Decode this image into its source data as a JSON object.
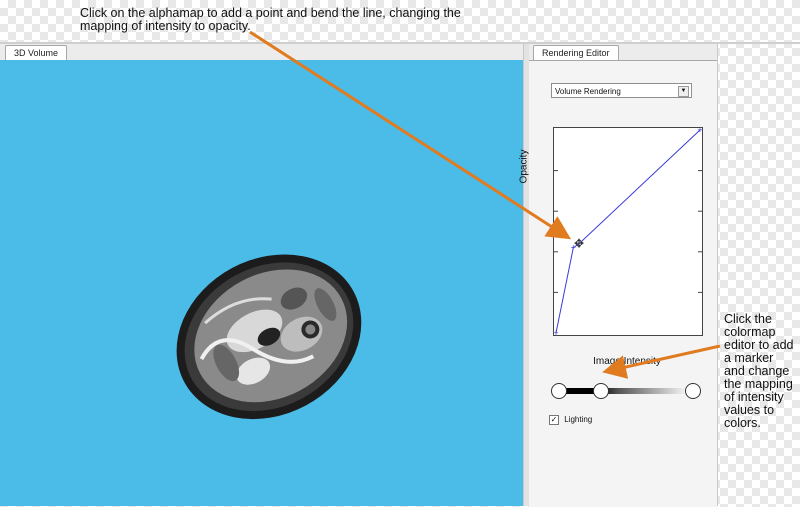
{
  "callouts": {
    "top": "Click on the alphamap to add a point and bend the line, changing the mapping of intensity to opacity.",
    "right": "Click the colormap editor to add a marker and change the mapping of intensity values to colors."
  },
  "left_panel": {
    "tab": "3D Volume"
  },
  "right_panel": {
    "tab": "Rendering Editor",
    "dropdown_value": "Volume Rendering",
    "lighting_label": "Lighting",
    "lighting_checked": true
  },
  "chart_data": {
    "type": "line",
    "xlabel": "Image Intensity",
    "ylabel": "Opacity",
    "xlim": [
      0,
      1
    ],
    "ylim": [
      0,
      1
    ],
    "series": [
      {
        "x": [
          0.0,
          0.12,
          0.16,
          1.0
        ],
        "y": [
          0.0,
          0.42,
          0.44,
          1.0
        ]
      }
    ]
  },
  "colormap_markers": [
    0.0,
    0.31,
    1.0
  ],
  "colors": {
    "viewport_bg": "#4bbbe8",
    "alphamap_line": "#3b3bd6",
    "arrow": "#e07b1f"
  }
}
